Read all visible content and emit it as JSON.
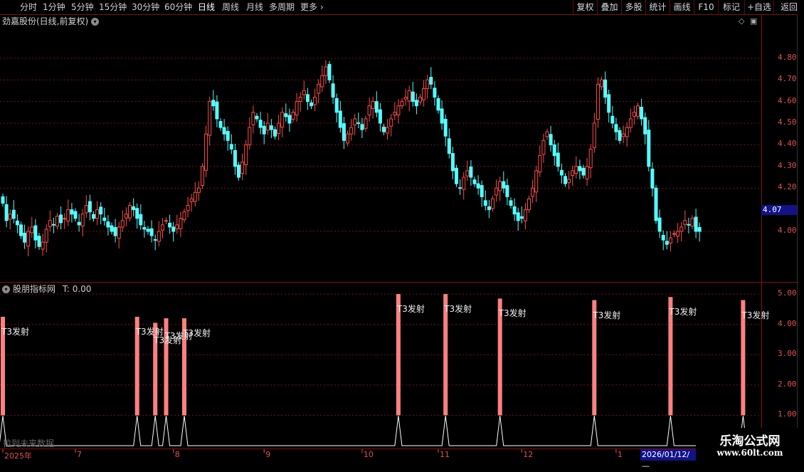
{
  "toolbar": {
    "periods": [
      "分时",
      "1分钟",
      "5分钟",
      "15分钟",
      "30分钟",
      "60分钟",
      "日线",
      "周线",
      "月线",
      "多周期",
      "更多"
    ],
    "active_period": "日线",
    "right_buttons": [
      "复权",
      "叠加",
      "多股",
      "统计",
      "画线",
      "F10",
      "标记",
      "+自选",
      "返回"
    ]
  },
  "main_pane": {
    "title": "劲嘉股份(日线,前复权)"
  },
  "indicator_pane": {
    "title": "股朋指标网",
    "value_label": "T: 0.00",
    "future_text": "拉到未来数据"
  },
  "price_axis": [
    "4.80",
    "4.70",
    "4.60",
    "4.50",
    "4.40",
    "4.30",
    "4.20",
    "4.00"
  ],
  "last_price": "4.07",
  "indicator_axis": [
    "5.00",
    "4.00",
    "3.00",
    "2.00",
    "1.00"
  ],
  "time_axis": [
    "2025年",
    "7",
    "8",
    "9",
    "10",
    "11",
    "12",
    "1"
  ],
  "cursor_date": "2026/01/12/—",
  "watermark": {
    "line1": "乐淘公式网",
    "line2": "www.60lt.com"
  },
  "signal_label": "T3发射",
  "colors": {
    "up": "#ff4a4a",
    "down": "#54ffff",
    "grid": "#7a1010",
    "signal_bar": "#ff8080",
    "axis_text": "#e05050"
  },
  "chart_data": [
    {
      "type": "candlestick",
      "title": "劲嘉股份(日线,前复权)",
      "y_ticks": [
        4.0,
        4.2,
        4.3,
        4.4,
        4.5,
        4.6,
        4.7,
        4.8
      ],
      "ylim": [
        3.85,
        4.95
      ],
      "x_ticks": [
        "2025年",
        "7",
        "8",
        "9",
        "10",
        "11",
        "12",
        "1"
      ],
      "last_price": 4.07,
      "closes": [
        4.13,
        4.05,
        4.08,
        4.06,
        4.03,
        3.98,
        3.95,
        4.0,
        4.02,
        3.96,
        3.93,
        3.95,
        4.01,
        4.05,
        4.03,
        4.07,
        4.04,
        4.06,
        4.1,
        4.08,
        4.06,
        4.03,
        4.08,
        4.12,
        4.09,
        4.06,
        4.1,
        4.08,
        4.05,
        4.02,
        4.0,
        3.98,
        4.02,
        4.05,
        4.08,
        4.12,
        4.1,
        4.06,
        4.03,
        4.01,
        4.0,
        3.98,
        3.96,
        4.0,
        4.03,
        4.05,
        4.02,
        4.0,
        4.03,
        4.06,
        4.09,
        4.12,
        4.15,
        4.18,
        4.2,
        4.3,
        4.45,
        4.6,
        4.58,
        4.52,
        4.48,
        4.45,
        4.42,
        4.38,
        4.3,
        4.25,
        4.32,
        4.4,
        4.48,
        4.55,
        4.52,
        4.48,
        4.45,
        4.5,
        4.47,
        4.44,
        4.5,
        4.55,
        4.53,
        4.5,
        4.55,
        4.6,
        4.62,
        4.65,
        4.6,
        4.58,
        4.62,
        4.68,
        4.72,
        4.76,
        4.7,
        4.62,
        4.55,
        4.48,
        4.42,
        4.45,
        4.48,
        4.52,
        4.5,
        4.47,
        4.52,
        4.58,
        4.6,
        4.55,
        4.5,
        4.46,
        4.48,
        4.52,
        4.55,
        4.58,
        4.6,
        4.62,
        4.65,
        4.6,
        4.58,
        4.62,
        4.66,
        4.7,
        4.68,
        4.62,
        4.56,
        4.5,
        4.44,
        4.36,
        4.28,
        4.22,
        4.2,
        4.25,
        4.28,
        4.25,
        4.22,
        4.2,
        4.16,
        4.12,
        4.1,
        4.15,
        4.2,
        4.23,
        4.2,
        4.16,
        4.12,
        4.08,
        4.05,
        4.06,
        4.1,
        4.15,
        4.2,
        4.28,
        4.35,
        4.42,
        4.46,
        4.4,
        4.35,
        4.3,
        4.26,
        4.22,
        4.24,
        4.28,
        4.3,
        4.28,
        4.26,
        4.3,
        4.38,
        4.5,
        4.68,
        4.7,
        4.62,
        4.55,
        4.5,
        4.46,
        4.42,
        4.45,
        4.48,
        4.52,
        4.55,
        4.58,
        4.52,
        4.45,
        4.3,
        4.2,
        4.05,
        4.0,
        3.96,
        3.94,
        3.97,
        3.99,
        4.0,
        4.02,
        4.05,
        4.03,
        4.06,
        4.0,
        4.0
      ],
      "signal_indices": [
        0,
        37,
        42,
        45,
        50,
        109,
        122,
        137,
        163,
        184,
        204
      ]
    },
    {
      "type": "bar",
      "title": "股朋指标网",
      "value_label": "T: 0.00",
      "y_ticks": [
        1.0,
        2.0,
        3.0,
        4.0,
        5.0
      ],
      "ylim": [
        0,
        5.4
      ],
      "series": [
        {
          "values": [
            4.25,
            4.25,
            4.05,
            4.2,
            4.2,
            5.0,
            5.0,
            4.85,
            4.8,
            4.9,
            4.8
          ]
        }
      ],
      "labels": [
        "T3发射",
        "T3发射",
        "T3发射",
        "T3发射",
        "T3发射",
        "T3发射",
        "T3发射",
        "T3发射",
        "T3发射",
        "T3发射",
        "T3发射"
      ]
    }
  ]
}
